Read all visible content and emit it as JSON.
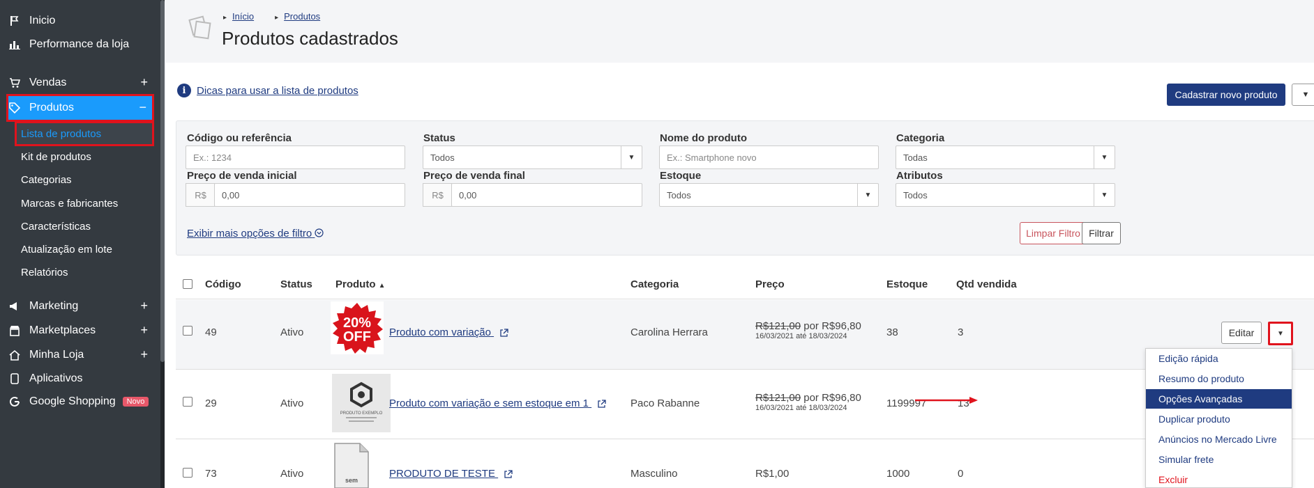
{
  "sidebar": {
    "items": [
      {
        "label": "Inicio",
        "icon": "flag-icon"
      },
      {
        "label": "Performance da loja",
        "icon": "bar-chart-icon"
      },
      {
        "label": "Vendas",
        "icon": "cart-icon"
      },
      {
        "label": "Produtos",
        "icon": "tag-icon"
      },
      {
        "label": "Marketing",
        "icon": "megaphone-icon"
      },
      {
        "label": "Marketplaces",
        "icon": "store-icon"
      },
      {
        "label": "Minha Loja",
        "icon": "home-icon"
      },
      {
        "label": "Aplicativos",
        "icon": "phone-icon"
      },
      {
        "label": "Google Shopping",
        "icon": "google-icon"
      }
    ],
    "sub_items": [
      "Lista de produtos",
      "Kit de produtos",
      "Categorias",
      "Marcas e fabricantes",
      "Características",
      "Atualização em lote",
      "Relatórios"
    ],
    "badge": "Novo",
    "active_color": "#1a9bfc",
    "highlight_color": "#e0131d"
  },
  "header": {
    "breadcrumb": [
      "Início",
      "Produtos"
    ],
    "title": "Produtos cadastrados"
  },
  "tips": {
    "label": "Dicas para usar a lista de produtos"
  },
  "actions": {
    "new_product": "Cadastrar novo produto"
  },
  "filters": {
    "code_label": "Código ou referência",
    "code_placeholder": "Ex.: 1234",
    "status_label": "Status",
    "status_value": "Todos",
    "name_label": "Nome do produto",
    "name_placeholder": "Ex.: Smartphone novo",
    "category_label": "Categoria",
    "category_value": "Todas",
    "price_start_label": "Preço de venda inicial",
    "price_start_value": "0,00",
    "price_end_label": "Preço de venda final",
    "price_end_value": "0,00",
    "currency_prefix": "R$",
    "stock_label": "Estoque",
    "stock_value": "Todos",
    "attributes_label": "Atributos",
    "attributes_value": "Todos",
    "more_label": "Exibir mais opções de filtro",
    "clear_label": "Limpar Filtro",
    "filter_label": "Filtrar"
  },
  "table": {
    "headers": {
      "code": "Código",
      "status": "Status",
      "product": "Produto",
      "category": "Categoria",
      "price": "Preço",
      "stock": "Estoque",
      "sold": "Qtd vendida"
    },
    "rows": [
      {
        "code": "49",
        "status": "Ativo",
        "product": "Produto com variação",
        "category": "Carolina Herrara",
        "price_old": "R$121,00",
        "price_sep": "por",
        "price_new": "R$96,80",
        "price_period": "16/03/2021 até 18/03/2024",
        "stock": "38",
        "sold": "3",
        "thumb_text_1": "20%",
        "thumb_text_2": "OFF"
      },
      {
        "code": "29",
        "status": "Ativo",
        "product": "Produto com variação e sem estoque em 1",
        "category": "Paco Rabanne",
        "price_old": "R$121,00",
        "price_sep": "por",
        "price_new": "R$96,80",
        "price_period": "16/03/2021 até 18/03/2024",
        "stock": "1199997",
        "sold": "13",
        "thumb_text_1": "PRODUTO EXEMPLO"
      },
      {
        "code": "73",
        "status": "Ativo",
        "product": "PRODUTO DE TESTE",
        "category": "Masculino",
        "price": "R$1,00",
        "stock": "1000",
        "sold": "0",
        "thumb_text_1": "sem"
      }
    ]
  },
  "row_actions": {
    "edit": "Editar"
  },
  "dropdown_menu": [
    "Edição rápida",
    "Resumo do produto",
    "Opções Avançadas",
    "Duplicar produto",
    "Anúncios no Mercado Livre",
    "Simular frete",
    "Excluir"
  ],
  "colors": {
    "primary": "#1f3b80",
    "sidebar_bg": "#343a40",
    "danger": "#e0131d"
  }
}
